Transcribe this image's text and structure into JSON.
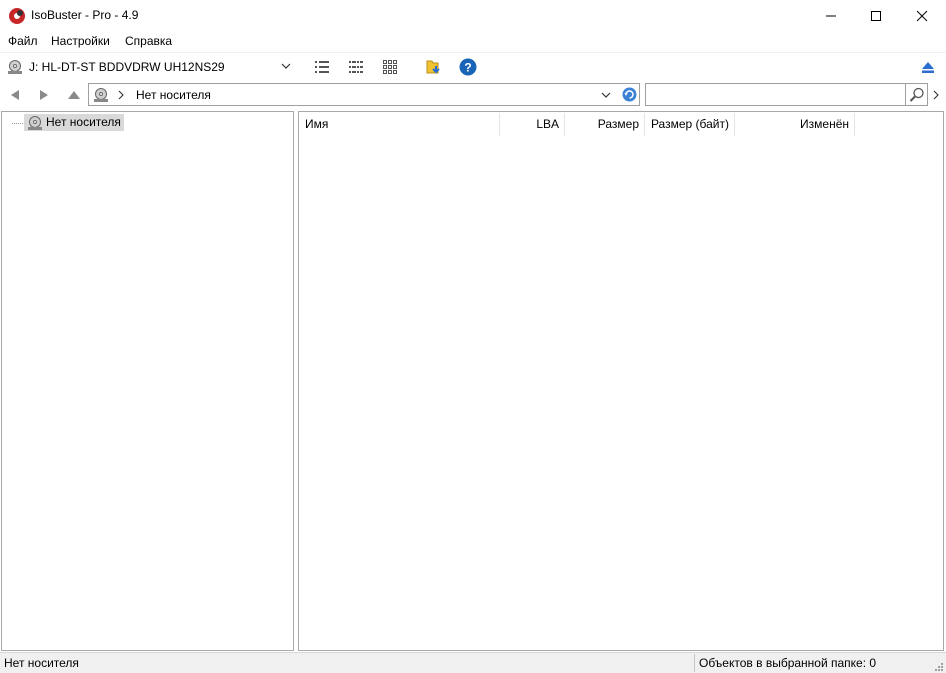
{
  "window": {
    "title": "IsoBuster - Pro - 4.9"
  },
  "menu": {
    "items": [
      "Файл",
      "Настройки",
      "Справка"
    ]
  },
  "toolbar": {
    "drive": "J: HL-DT-ST  BDDVDRW UH12NS29"
  },
  "nav": {
    "address_segment": "Нет носителя",
    "search_value": ""
  },
  "tree": {
    "root_label": "Нет носителя"
  },
  "list": {
    "columns": [
      "Имя",
      "LBA",
      "Размер",
      "Размер (байт)",
      "Изменён"
    ]
  },
  "status": {
    "left": "Нет носителя",
    "right": "Объектов в выбранной папке: 0"
  },
  "colors": {
    "help_blue": "#1a64b8",
    "eject_blue": "#2a6fcf",
    "folder_yellow": "#f1c232"
  }
}
